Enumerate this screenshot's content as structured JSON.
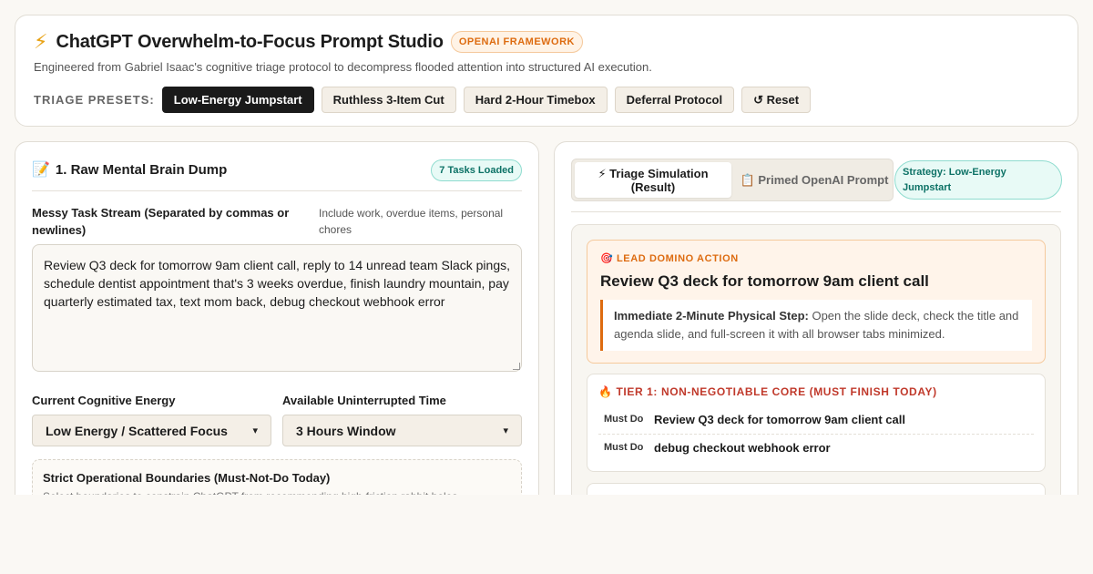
{
  "header": {
    "title": "ChatGPT Overwhelm-to-Focus Prompt Studio",
    "badge": "OPENAI FRAMEWORK",
    "subtitle": "Engineered from Gabriel Isaac's cognitive triage protocol to decompress flooded attention into structured AI execution.",
    "presets_label": "TRIAGE PRESETS:",
    "presets": [
      "Low-Energy Jumpstart",
      "Ruthless 3-Item Cut",
      "Hard 2-Hour Timebox",
      "Deferral Protocol"
    ],
    "reset_label": "↺ Reset"
  },
  "left": {
    "section_title": "1. Raw Mental Brain Dump",
    "tasks_badge": "7 Tasks Loaded",
    "stream_label": "Messy Task Stream (Separated by commas or newlines)",
    "stream_hint": "Include work, overdue items, personal chores",
    "stream_value": "Review Q3 deck for tomorrow 9am client call, reply to 14 unread team Slack pings, schedule dentist appointment that's 3 weeks overdue, finish laundry mountain, pay quarterly estimated tax, text mom back, debug checkout webhook error",
    "energy_label": "Current Cognitive Energy",
    "energy_value": "Low Energy / Scattered Focus",
    "time_label": "Available Uninterrupted Time",
    "time_value": "3 Hours Window",
    "boundaries_title": "Strict Operational Boundaries (Must-Not-Do Today)",
    "boundaries_desc": "Select boundaries to constrain ChatGPT from recommending high-friction rabbit holes."
  },
  "right": {
    "tab_simulation": "⚡ Triage Simulation (Result)",
    "tab_prompt": "📋 Primed OpenAI Prompt",
    "strategy_badge": "Strategy: Low-Energy Jumpstart",
    "lead_label": "🎯 LEAD DOMINO ACTION",
    "lead_title": "Review Q3 deck for tomorrow 9am client call",
    "lead_step_label": "Immediate 2-Minute Physical Step:",
    "lead_step_text": "Open the slide deck, check the title and agenda slide, and full-screen it with all browser tabs minimized.",
    "tier1_label": "🔥 TIER 1: NON-NEGOTIABLE CORE (MUST FINISH TODAY)",
    "tier1_items": [
      {
        "tag": "Must Do",
        "task": "Review Q3 deck for tomorrow 9am client call"
      },
      {
        "tag": "Must Do",
        "task": "debug checkout webhook error"
      }
    ]
  }
}
